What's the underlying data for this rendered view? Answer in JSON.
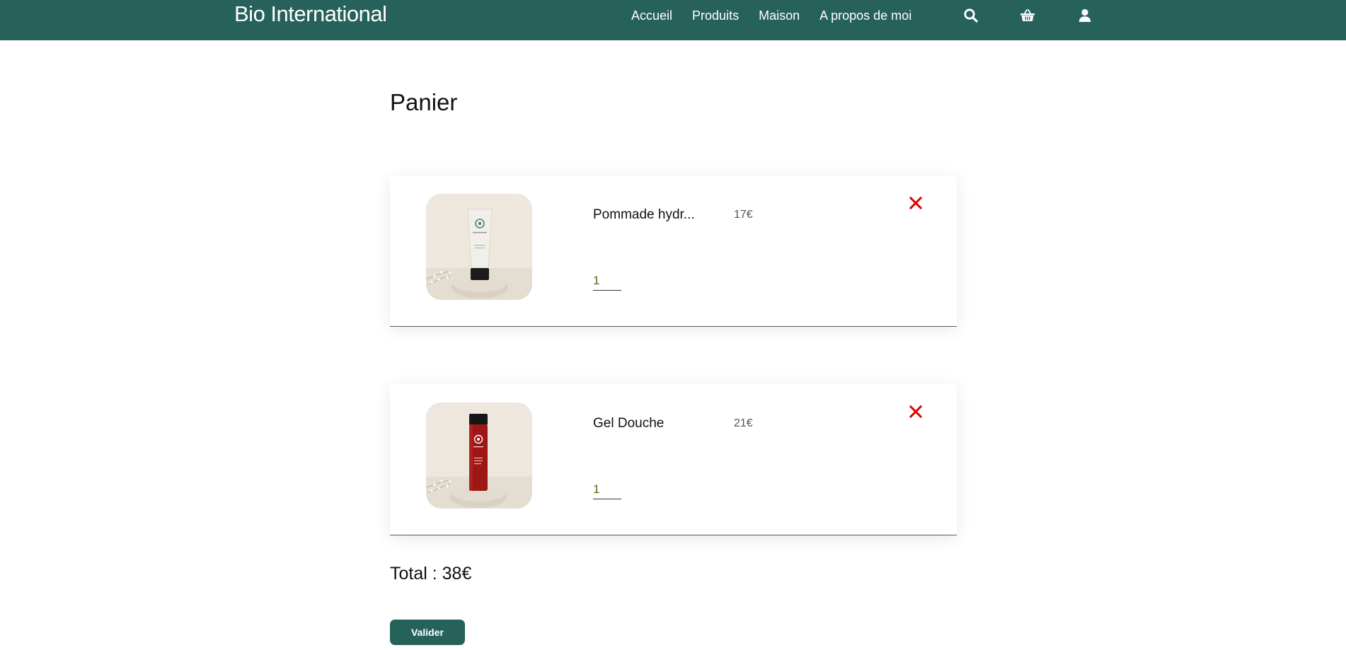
{
  "header": {
    "brand": "Bio International",
    "nav": [
      "Accueil",
      "Produits",
      "Maison",
      "A propos de moi"
    ],
    "icons": [
      "search-icon",
      "basket-icon",
      "user-icon"
    ],
    "background_color": "#26625a"
  },
  "cart": {
    "title": "Panier",
    "items": [
      {
        "name": "Pommade hydr...",
        "price": "17€",
        "quantity": "1",
        "image": "cream-tube-product-image"
      },
      {
        "name": "Gel Douche",
        "price": "21€",
        "quantity": "1",
        "image": "shower-gel-bottle-product-image"
      }
    ],
    "total_label": "Total : ",
    "total_value": "38€",
    "submit_label": "Valider",
    "remove_color": "#e00000"
  }
}
